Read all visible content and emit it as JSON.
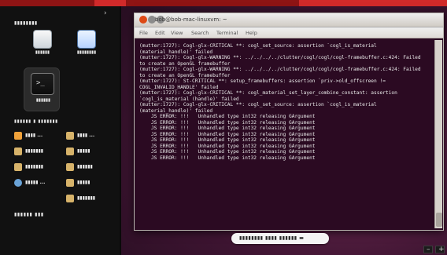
{
  "sidebar": {
    "title": "▮▮▮▮▮▮▮▮",
    "tiles": [
      {
        "label": "▮▮▮▮▮▮"
      },
      {
        "label": "▮▮▮▮▮▮▮▮"
      },
      {
        "label": "▮▮▮▮▮▮"
      }
    ],
    "places_title": "▮▮▮▮▮▮ ▮ ▮▮▮▮▮▮▮",
    "places": [
      {
        "label": "▮▮▮▮ ..."
      },
      {
        "label": "▮▮▮▮▮▮▮"
      },
      {
        "label": "▮▮▮▮▮▮▮"
      },
      {
        "label": "▮▮▮▮▮ ..."
      },
      {
        "label": "▮▮▮▮ ..."
      },
      {
        "label": "▮▮▮▮▮"
      },
      {
        "label": "▮▮▮▮▮▮"
      },
      {
        "label": "▮▮▮▮▮"
      },
      {
        "label": "▮▮▮▮▮▮▮"
      }
    ],
    "bottom_title": "▮▮▮▮▮▮ ▮▮▮"
  },
  "terminal": {
    "title": "bob@bob-mac-linuxvm: ~",
    "menu": [
      "File",
      "Edit",
      "View",
      "Search",
      "Terminal",
      "Help"
    ],
    "lines": [
      "(mutter:1727): Cogl-glx-CRITICAL **: cogl_set_source: assertion `cogl_is_material (material_handle)' failed",
      "",
      "(mutter:1727): Cogl-glx-WARNING **: ../../../../clutter/cogl/cogl/cogl-framebuffer.c:424: Failed to create an OpenGL framebuffer",
      "",
      "(mutter:1727): Cogl-glx-WARNING **: ../../../../clutter/cogl/cogl/cogl-framebuffer.c:424: Failed to create an OpenGL framebuffer",
      "",
      "(mutter:1727): St-CRITICAL **: setup_framebuffers: assertion `priv->old_offscreen != COGL_INVALID_HANDLE' failed",
      "",
      "(mutter:1727): Cogl-glx-CRITICAL **: cogl_material_set_layer_combine_constant: assertion `cogl_is_material (handle)' failed",
      "",
      "(mutter:1727): Cogl-glx-CRITICAL **: cogl_set_source: assertion `cogl_is_material (material_handle)' failed",
      "    JS ERROR: !!!   Unhandled type int32 releasing GArgument",
      "    JS ERROR: !!!   Unhandled type int32 releasing GArgument",
      "    JS ERROR: !!!   Unhandled type int32 releasing GArgument",
      "    JS ERROR: !!!   Unhandled type int32 releasing GArgument",
      "    JS ERROR: !!!   Unhandled type int32 releasing GArgument",
      "    JS ERROR: !!!   Unhandled type int32 releasing GArgument",
      "    JS ERROR: !!!   Unhandled type int32 releasing GArgument",
      "    JS ERROR: !!!   Unhandled type int32 releasing GArgument"
    ]
  },
  "taskbar": {
    "label": "▮▮▮▮▮▮▮▮ ▮▮▮▮ ▮▮▮▮▮▮ ▬"
  },
  "corner_controls": {
    "left_glyph": "–",
    "right_glyph": "+"
  },
  "colors": {
    "accent": "#dd4814",
    "terminal_bg": "#2b0a22"
  }
}
